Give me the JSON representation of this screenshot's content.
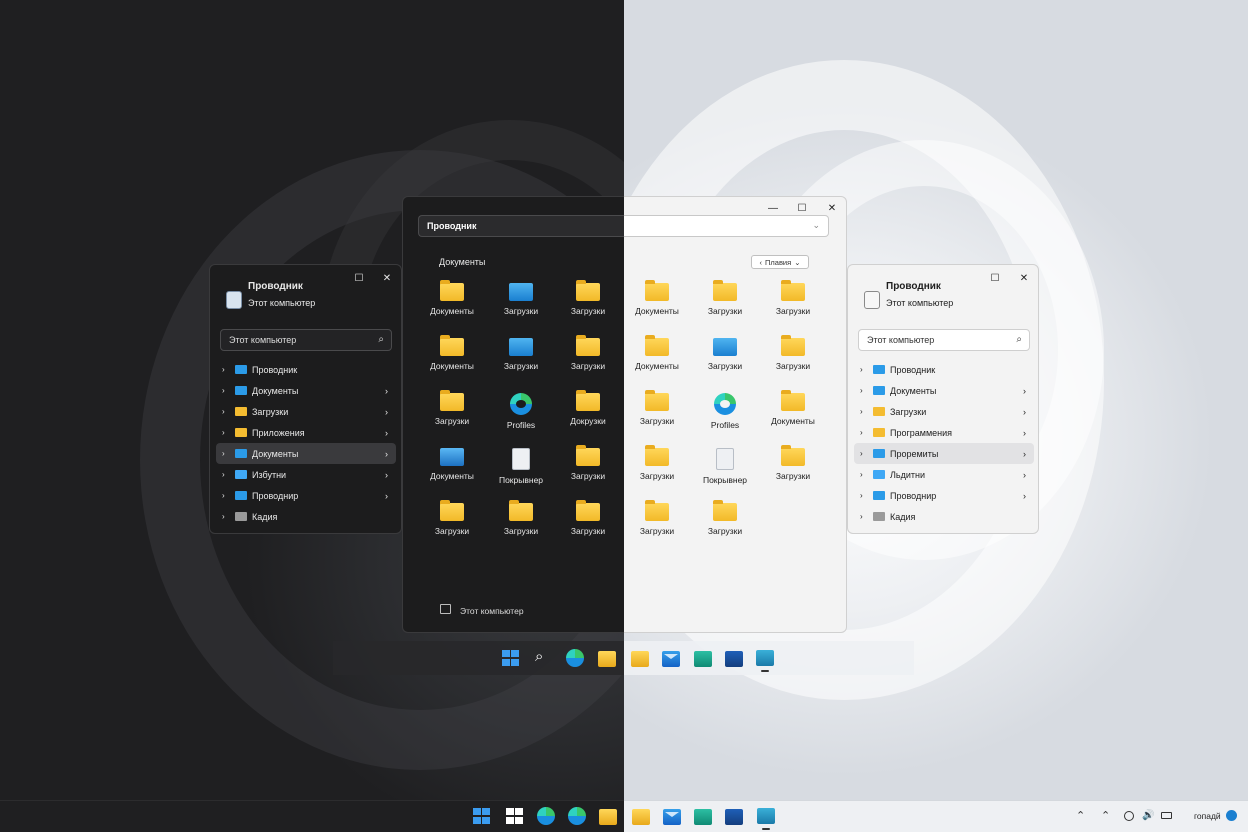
{
  "left_window": {
    "title": "Проводник",
    "subtitle": "Этот компьютер",
    "search_placeholder": "Этот компьютер",
    "items": [
      {
        "label": "Проводник",
        "icon": "monitor-icon",
        "color": "#2b9be8",
        "has_arrow": false
      },
      {
        "label": "Документы",
        "icon": "monitor-icon",
        "color": "#2b9be8",
        "has_arrow": true
      },
      {
        "label": "Загрузки",
        "icon": "folder-icon",
        "color": "#f4bc31",
        "has_arrow": true
      },
      {
        "label": "Приложения",
        "icon": "apps-icon",
        "color": "#f4bc31",
        "has_arrow": true
      },
      {
        "label": "Документы",
        "icon": "monitor-icon",
        "color": "#2b9be8",
        "has_arrow": true,
        "selected": true
      },
      {
        "label": "Избутни",
        "icon": "figure-icon",
        "color": "#3fa8f5",
        "has_arrow": true
      },
      {
        "label": "Проводнир",
        "icon": "monitor-icon",
        "color": "#2b9be8",
        "has_arrow": true
      },
      {
        "label": "Кадия",
        "icon": "disk-icon",
        "color": "#9a9a9a",
        "has_arrow": false
      }
    ]
  },
  "right_window": {
    "title": "Проводник",
    "subtitle": "Этот компьютер",
    "search_placeholder": "Этот компьютер",
    "items": [
      {
        "label": "Проводник",
        "icon": "monitor-icon",
        "color": "#2b9be8",
        "has_arrow": false
      },
      {
        "label": "Документы",
        "icon": "monitor-icon",
        "color": "#2b9be8",
        "has_arrow": true
      },
      {
        "label": "Загрузки",
        "icon": "folder-icon",
        "color": "#f4bc31",
        "has_arrow": true
      },
      {
        "label": "Программения",
        "icon": "apps-icon",
        "color": "#f4bc31",
        "has_arrow": true
      },
      {
        "label": "Проремиты",
        "icon": "monitor-icon",
        "color": "#2b9be8",
        "has_arrow": true,
        "selected": true
      },
      {
        "label": "Льдитни",
        "icon": "figure-icon",
        "color": "#3fa8f5",
        "has_arrow": true
      },
      {
        "label": "Проводнир",
        "icon": "monitor-icon",
        "color": "#2b9be8",
        "has_arrow": true
      },
      {
        "label": "Кадия",
        "icon": "disk-icon",
        "color": "#9a9a9a",
        "has_arrow": false
      }
    ]
  },
  "main_window": {
    "address": "Проводник",
    "section_title": "Документы",
    "view_button": "Плавия",
    "footer": "Этот компьютер",
    "dark_grid": [
      [
        {
          "label": "Документы",
          "icon": "folder"
        },
        {
          "label": "Загрузки",
          "icon": "bluefolder"
        },
        {
          "label": "Загрузки",
          "icon": "folder"
        }
      ],
      [
        {
          "label": "Документы",
          "icon": "folder"
        },
        {
          "label": "Загрузки",
          "icon": "bluefolder"
        },
        {
          "label": "Загрузки",
          "icon": "folder"
        }
      ],
      [
        {
          "label": "Загрузки",
          "icon": "folder"
        },
        {
          "label": "Profiles",
          "icon": "edge"
        },
        {
          "label": "Докрузки",
          "icon": "folder"
        }
      ],
      [
        {
          "label": "Документы",
          "icon": "photo"
        },
        {
          "label": "Покрывнер",
          "icon": "doc"
        },
        {
          "label": "Загрузки",
          "icon": "folder"
        }
      ],
      [
        {
          "label": "Загрузки",
          "icon": "folder"
        },
        {
          "label": "Загрузки",
          "icon": "folder"
        },
        {
          "label": "Загрузки",
          "icon": "folder"
        }
      ]
    ],
    "light_grid": [
      [
        {
          "label": "Документы",
          "icon": "folder"
        },
        {
          "label": "Загрузки",
          "icon": "folder"
        },
        {
          "label": "Загрузки",
          "icon": "folder"
        }
      ],
      [
        {
          "label": "Документы",
          "icon": "folder"
        },
        {
          "label": "Загрузки",
          "icon": "bluefolder"
        },
        {
          "label": "Загрузки",
          "icon": "folder"
        }
      ],
      [
        {
          "label": "Загрузки",
          "icon": "folder"
        },
        {
          "label": "Profiles",
          "icon": "edge"
        },
        {
          "label": "Документы",
          "icon": "folder"
        }
      ],
      [
        {
          "label": "Загрузки",
          "icon": "folder"
        },
        {
          "label": "Покрывнер",
          "icon": "doc"
        },
        {
          "label": "Загрузки",
          "icon": "folder"
        }
      ],
      [
        {
          "label": "Загрузки",
          "icon": "folder"
        },
        {
          "label": "Загрузки",
          "icon": "folder"
        }
      ]
    ]
  },
  "taskbar": {
    "clock": "гопадй"
  },
  "colors": {
    "accent": "#2b9be8",
    "folder": "#f4bc31",
    "dark_bg": "#1c1c1d",
    "light_bg": "#f3f3f3"
  }
}
